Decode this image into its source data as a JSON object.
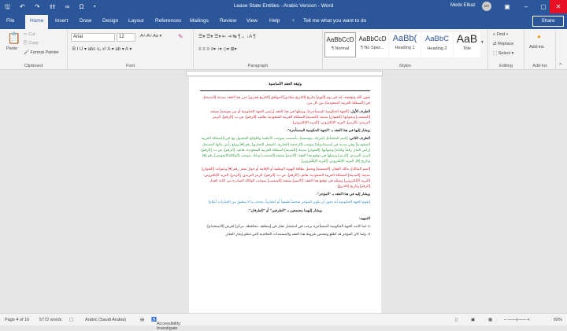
{
  "titlebar": {
    "title": "Lease State Entities - Arabic Version  -  Word",
    "user": "Medo Elbaz",
    "initials": "ME",
    "quick_access": "🖫 ↶ ↷ ☷ ∞ Ω ▾"
  },
  "tabs": [
    "File",
    "Home",
    "Insert",
    "Draw",
    "Design",
    "Layout",
    "References",
    "Mailings",
    "Review",
    "View",
    "Help"
  ],
  "tell_me": "Tell me what you want to do",
  "share": "Share",
  "clipboard": {
    "paste": "Paste",
    "cut": "Cut",
    "copy": "Copy",
    "format_painter": "Format Painter",
    "label": "Clipboard"
  },
  "font": {
    "name": "Arial",
    "size": "12",
    "label": "Font",
    "row2": "B  I  U ▾ abc x₂ x²  A ▾  ab ▾  A ▾",
    "row1_tools": "A˄ A˅  Aa ▾"
  },
  "paragraph": {
    "label": "Paragraph",
    "row1": "☰▾ ☰▾ ☰▾  ⇤ ⇥  ↹ ¶↔  ↓A  ¶",
    "row2": "≡ ≡ ≡ ≡▾  ↕▾  ◇▾ ⊞▾"
  },
  "styles": {
    "label": "Styles",
    "items": [
      {
        "preview": "AaBbCcD",
        "name": "¶ Normal"
      },
      {
        "preview": "AaBbCcD",
        "name": "¶ No Spac..."
      },
      {
        "preview": "AaBb(",
        "name": "Heading 1"
      },
      {
        "preview": "AaBbC",
        "name": "Heading 2"
      },
      {
        "preview": "AaB",
        "name": "Title"
      }
    ]
  },
  "editing": {
    "find": "Find",
    "replace": "Replace",
    "select": "Select",
    "label": "Editing"
  },
  "addins": {
    "button": "Add-ins",
    "label": "Add-ins"
  },
  "document": {
    "heading": "وثيقة العقد الأساسية",
    "intro": "بعون الله وتوفيقه، إنه في يوم [اليوم] بتاريخ [التاريخ ميلادي] الموافق [التاريخ هجري] حرر هذا العقد بمدينة [المدينة]، في [المملكة العربية السعودية]، بين كل من:",
    "party1_label": "الطرف الأول:",
    "party1": "[الجهة الحكومية المستأجرة]، ويمثلها في هذا العقد [رئيس الجهة الحكومية أو من يفوضه] بصفته [المنصب] وعنوانها: [العنوان] مدينة: [المدينة] المملكة العربية السعودية، هاتف: [الرقم]، ص.ب: [الرقم]، الرمز البريدي: [الرمز]، البريد الإلكتروني: [البريد الإلكتروني]",
    "party1_ref": "ويشار إليها في هذا العقد بـ \"الجهة الحكومية المستأجرة\".",
    "party2_label": "الطرف الثاني:",
    "party2a": "[اسم المنشأة]، [شركة، مؤسسة]، تأسست بموجب الأنظمة واللوائح المعمول بها في [المملكة العربية السعودية] وفي مدينة في [مدينة/دولة] بموجب [الرخصة التجارية، السجل التجاري] رقم [●] ويبلغ رأس مالها المسجل [رأس المال رقماً وكتابة] وعنوانها: [العنوان] مدينة: [المدينة] المملكة العربية السعودية، هاتف: [الرقم]، ص.ب: [الرقم]، الرمز البريدي: [الرمز] ويمثلها في توقيع هذا العقد: [الاسم] بصفته [المنصب] وذلك بموجب [الوكالة/التفويض] رقم [●] وتاريخ [●]، البريد الإلكتروني: [البريد الإلكتروني]",
    "party2b": "[اسم المالك]، مالك العقار، [الجنسية] ويحمل بطاقة الهوية الوطنية أو الإقامة أو جواز سفر رقم [●] وعنوانه: [العنوان] مدينة: [المدينة] المملكة العربية السعودية، هاتف: [الرقم]، ص.ب: [الرقم]، الرمز البريدي: [الرمز]، البريد الإلكتروني: [البريد الإلكتروني] ويمثله في توقيع هذا العقد: [الاسم] بصفته [المنصب] بموجب الوكالة الصادرة من كتابة العدل [الرقم] وتاريخ [التاريخ]",
    "party2_ref": "ويشار إليه في هذا العقد بـ \"المؤجر\".",
    "note": "[تقوم الجهة الحكومية أنه يجوز أن يكون المؤجر شخصاً طبيعياً أو اعتبارياً، يحذف ما لا ينطبق من الخيارات أعلاه]",
    "both_ref": "ويشار إليهما مجتمعين بـ \"الطرفين\" أو \"الطرفان\".",
    "preamble_label": "التمهيد:",
    "item1": "1.  لما كانت الجهة الحكومية المستأجرة ترغب في استئجار عقار في [منطقة، محافظة، مركز] لغرض [الاستخدام].",
    "item2": "2.  ولما كان المؤجر قد اطلع وتفحص شروط هذا العقد والمستندات التعاقدية التي تنظم إيجار العقار."
  },
  "status": {
    "page": "Page 4 of 16",
    "words": "5772 words",
    "language": "Arabic (Saudi Arabia)",
    "accessibility": "Accessibility: Investigate",
    "zoom": "60%",
    "zoom_fraction": 0.6
  }
}
